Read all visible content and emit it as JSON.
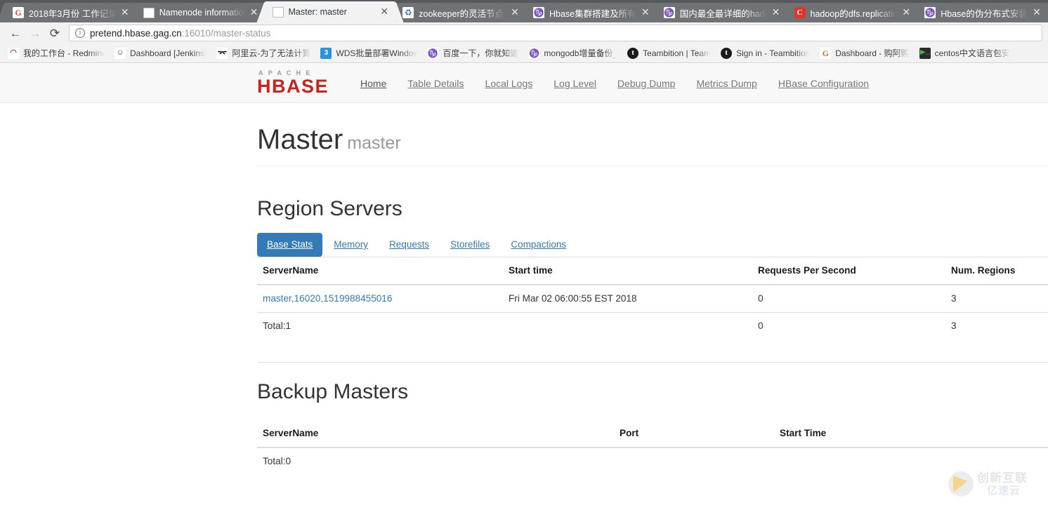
{
  "browser": {
    "tabs": [
      {
        "title": "2018年3月份 工作记录",
        "favicon": "google-icon",
        "favicon_class": "fav-g",
        "favicon_glyph": "G",
        "active": false
      },
      {
        "title": "Namenode information",
        "favicon": "page-icon",
        "favicon_class": "fav-doc",
        "favicon_glyph": "",
        "active": false
      },
      {
        "title": "Master: master",
        "favicon": "page-icon",
        "favicon_class": "fav-doc",
        "favicon_glyph": "",
        "active": true
      },
      {
        "title": "zookeeper的灵活节点_",
        "favicon": "baidu-icon",
        "favicon_class": "fav-blue",
        "favicon_glyph": "♻",
        "active": false
      },
      {
        "title": "Hbase集群搭建及所有ţ",
        "favicon": "baidu-icon",
        "favicon_class": "fav-blue",
        "favicon_glyph": "♑",
        "active": false
      },
      {
        "title": "国内最全最详细的hado",
        "favicon": "baidu-icon",
        "favicon_class": "fav-blue",
        "favicon_glyph": "♑",
        "active": false
      },
      {
        "title": "hadoop的dfs.replicatio",
        "favicon": "csdn-icon",
        "favicon_class": "fav-red",
        "favicon_glyph": "C",
        "active": false
      },
      {
        "title": "Hbase的伪分布式安装",
        "favicon": "baidu-icon",
        "favicon_class": "fav-blue",
        "favicon_glyph": "♑",
        "active": false
      }
    ],
    "close_glyph": "✕",
    "nav": {
      "back_glyph": "←",
      "forward_glyph": "→",
      "reload_glyph": "⟳"
    },
    "omnibox": {
      "info_glyph": "i",
      "host": "pretend.hbase.gag.cn",
      "rest": ":16010/master-status"
    },
    "bookmarks": [
      {
        "label": "我的工作台 - Redmine",
        "icon": "redmine-icon",
        "icon_class": "ic-redmine",
        "glyph": "◠"
      },
      {
        "label": "Dashboard [Jenkins]",
        "icon": "jenkins-icon",
        "icon_class": "ic-jenkins",
        "glyph": "☺"
      },
      {
        "label": "阿里云-为了无法计算",
        "icon": "aliyun-icon",
        "icon_class": "ic-aliyun",
        "glyph": "⌤"
      },
      {
        "label": "WDS批量部署Windows",
        "icon": "wds-icon",
        "icon_class": "ic-wds",
        "glyph": "3"
      },
      {
        "label": "百度一下，你就知道",
        "icon": "baidu-icon",
        "icon_class": "ic-baidu",
        "glyph": "♑"
      },
      {
        "label": "mongodb增量备份_",
        "icon": "baidu-icon",
        "icon_class": "ic-baidu",
        "glyph": "♑"
      },
      {
        "label": "Teambition | Team",
        "icon": "teambition-icon",
        "icon_class": "ic-teambition",
        "glyph": "t"
      },
      {
        "label": "Sign in - Teambition",
        "icon": "teambition-icon",
        "icon_class": "ic-teambition",
        "glyph": "t"
      },
      {
        "label": "Dashboard - 购阿购",
        "icon": "google-icon",
        "icon_class": "ic-gorange",
        "glyph": "G"
      },
      {
        "label": "centos中文语言包安",
        "icon": "terminal-icon",
        "icon_class": "ic-centos",
        "glyph": "▶_"
      }
    ]
  },
  "site": {
    "brand": {
      "apache": "APACHE",
      "hbase": "HBASE"
    },
    "nav_links": [
      {
        "label": "Home",
        "active": true
      },
      {
        "label": "Table Details",
        "active": false
      },
      {
        "label": "Local Logs",
        "active": false
      },
      {
        "label": "Log Level",
        "active": false
      },
      {
        "label": "Debug Dump",
        "active": false
      },
      {
        "label": "Metrics Dump",
        "active": false
      },
      {
        "label": "HBase Configuration",
        "active": false
      }
    ]
  },
  "header": {
    "title": "Master",
    "subtitle": "master"
  },
  "region_servers": {
    "heading": "Region Servers",
    "tabs": [
      {
        "label": "Base Stats",
        "active": true
      },
      {
        "label": "Memory",
        "active": false
      },
      {
        "label": "Requests",
        "active": false
      },
      {
        "label": "Storefiles",
        "active": false
      },
      {
        "label": "Compactions",
        "active": false
      }
    ],
    "columns": [
      "ServerName",
      "Start time",
      "Requests Per Second",
      "Num. Regions"
    ],
    "rows": [
      {
        "server_name": "master,16020,1519988455016",
        "start_time": "Fri Mar 02 06:00:55 EST 2018",
        "requests_per_second": "0",
        "num_regions": "3"
      }
    ],
    "total_row": {
      "label": "Total:1",
      "start_time": "",
      "requests_per_second": "0",
      "num_regions": "3"
    }
  },
  "backup_masters": {
    "heading": "Backup Masters",
    "columns": [
      "ServerName",
      "Port",
      "Start Time"
    ],
    "rows": [],
    "total_row": {
      "label": "Total:0",
      "port": "",
      "start_time": ""
    }
  },
  "watermark": {
    "line1": "创新互联",
    "line2": "亿速云"
  },
  "colors": {
    "brand_red": "#c4251e",
    "link_blue": "#337ab7",
    "tab_active_bg": "#337ab7",
    "chrome_bg": "#565a5e"
  }
}
